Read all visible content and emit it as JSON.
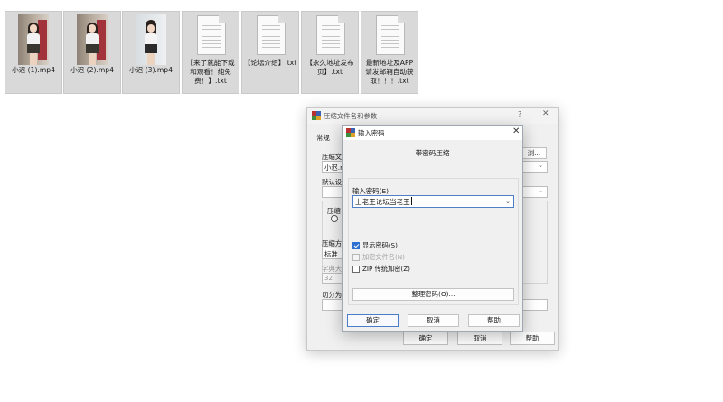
{
  "files": [
    {
      "name": "小迟 (1).mp4",
      "type": "video"
    },
    {
      "name": "小迟 (2).mp4",
      "type": "video"
    },
    {
      "name": "小迟 (3).mp4",
      "type": "video"
    },
    {
      "name_lines": [
        "【来了就能下载",
        "和观看！纯免",
        "费！】.txt"
      ],
      "type": "text"
    },
    {
      "name_lines": [
        "【论坛介绍】.txt"
      ],
      "type": "text"
    },
    {
      "name_lines": [
        "【永久地址发布",
        "页】.txt"
      ],
      "type": "text"
    },
    {
      "name_lines": [
        "最新地址及APP",
        "请发邮箱自动获",
        "取！！！.txt"
      ],
      "type": "text"
    }
  ],
  "archive_dialog": {
    "title": "压缩文件名和参数",
    "help_symbol": "?",
    "close_symbol": "✕",
    "tab_general": "常规",
    "filename_label": "压缩文",
    "filename_value": "小迟.r",
    "browse_label": "浏...",
    "default_label": "默认设",
    "format_label": "压缩",
    "method_label": "压缩方",
    "method_value": "标准",
    "dict_label": "字典大",
    "dict_value": "32",
    "split_label": "切分为",
    "ok_label": "确定",
    "cancel_label": "取消",
    "help_label": "帮助"
  },
  "password_dialog": {
    "title": "输入密码",
    "close_symbol": "✕",
    "heading": "带密码压缩",
    "password_label": "输入密码(E)",
    "password_value": "上老王论坛当老王",
    "dropdown_symbol": "⌄",
    "show_password_label": "显示密码(S)",
    "show_password_checked": true,
    "encrypt_names_label": "加密文件名(N)",
    "zip_legacy_label": "ZIP 传统加密(Z)",
    "organize_button": "整理密码(O)...",
    "ok_label": "确定",
    "cancel_label": "取消",
    "help_label": "帮助"
  }
}
